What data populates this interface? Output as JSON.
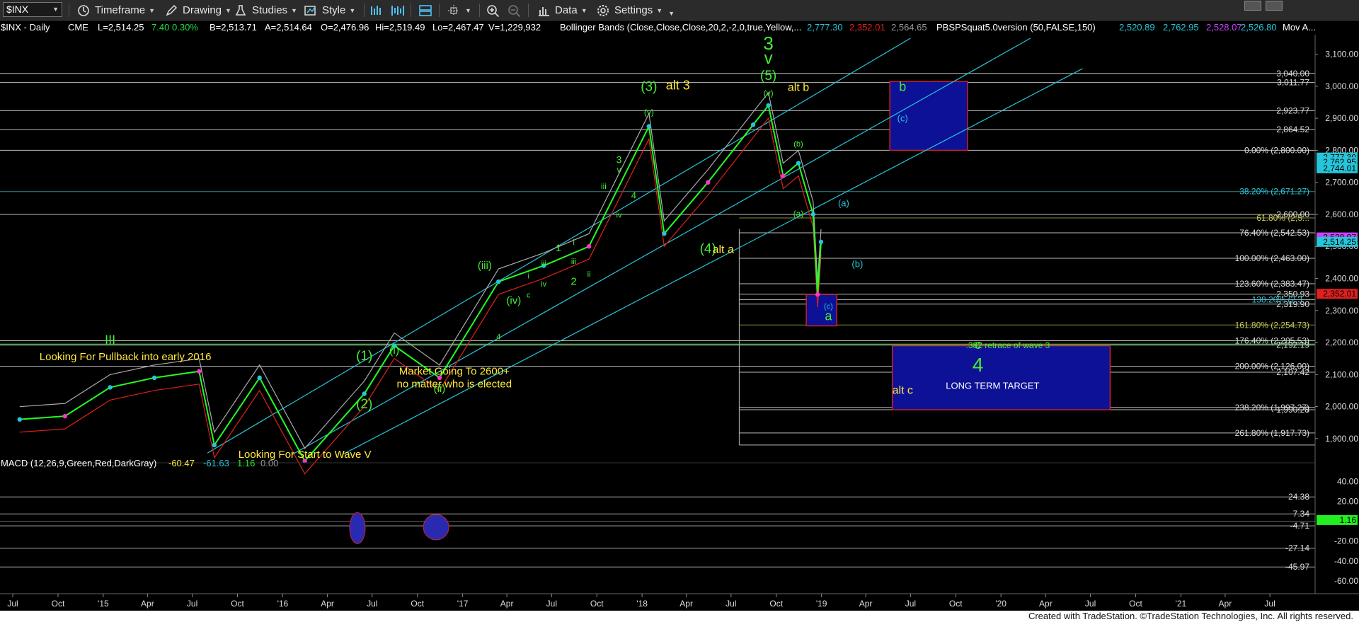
{
  "toolbar": {
    "symbol": "$INX",
    "timeframe": "Timeframe",
    "drawing": "Drawing",
    "studies": "Studies",
    "style": "Style",
    "data": "Data",
    "settings": "Settings"
  },
  "header": {
    "symbol_line": "$INX - Daily",
    "exchange": "CME",
    "last": "L=2,514.25",
    "change": "7.40",
    "pct": "0.30%",
    "bid": "B=2,513.71",
    "ask": "A=2,514.64",
    "open": "O=2,476.96",
    "high": "Hi=2,519.49",
    "low": "Lo=2,467.47",
    "volume": "V=1,229,932",
    "bb_label": "Bollinger Bands (Close,Close,Close,20,2,-2,0,true,Yellow,...",
    "bb_v1": "2,777.30",
    "bb_v2": "2,352.01",
    "bb_v3": "2,564.65",
    "pbs_label": "PBSPSquat5.0version (50,FALSE,150)",
    "pbs_v1": "2,520.89",
    "pbs_v2": "2,762.95",
    "pbs_v3": "2,528.07",
    "pbs_v4": "2,526.80",
    "mov": "Mov A..."
  },
  "macd_header": {
    "label": "MACD (12,26,9,Green,Red,DarkGray)",
    "v1": "-60.47",
    "v2": "-61.63",
    "v3": "1.16",
    "v4": "0.00"
  },
  "colors": {
    "price_up": "#22ff22",
    "price_down": "#ff2a2a",
    "bb_band": "#aaaaaa",
    "bb_red": "#e0201e",
    "cyan": "#26c6da",
    "yellow_text": "#ffea3b",
    "green_text": "#44ee33",
    "box_blue": "#0d1196",
    "box_border": "#cc2222",
    "macd_up": "#22ee22",
    "macd_down": "#ee2222"
  },
  "chart_data": [
    {
      "type": "line",
      "title": "$INX - Daily",
      "ylim": [
        1840,
        3150
      ],
      "y_ticks": [
        "3,100.00",
        "3,000.00",
        "2,900.00",
        "2,800.00",
        "2,700.00",
        "2,600.00",
        "2,500.00",
        "2,400.00",
        "2,300.00",
        "2,200.00",
        "2,100.00",
        "2,000.00",
        "1,900.00"
      ],
      "x_ticks": [
        "Jul",
        "Oct",
        "'15",
        "Apr",
        "Jul",
        "Oct",
        "'16",
        "Apr",
        "Jul",
        "Oct",
        "'17",
        "Apr",
        "Jul",
        "Oct",
        "'18",
        "Apr",
        "Jul",
        "Oct",
        "'19",
        "Apr",
        "Jul",
        "Oct",
        "'20",
        "Apr",
        "Jul",
        "Oct",
        "'21",
        "Apr",
        "Jul"
      ],
      "series": [
        {
          "x": [
            "2014-07",
            "2014-10",
            "2015-01",
            "2015-04",
            "2015-07",
            "2015-08",
            "2015-11",
            "2016-02",
            "2016-06",
            "2016-08",
            "2016-11",
            "2017-03",
            "2017-06",
            "2017-09",
            "2018-01",
            "2018-02",
            "2018-05",
            "2018-08",
            "2018-09",
            "2018-10",
            "2018-11",
            "2018-12",
            "2018-12-24",
            "2018-12-31"
          ],
          "values": [
            1960,
            1970,
            2060,
            2090,
            2110,
            1880,
            2090,
            1830,
            2040,
            2190,
            2090,
            2390,
            2440,
            2500,
            2875,
            2540,
            2700,
            2880,
            2940,
            2720,
            2760,
            2600,
            2350,
            2514
          ]
        }
      ],
      "price_levels": [
        {
          "label": "3,040.00",
          "value": 3040
        },
        {
          "label": "3,011.77",
          "value": 3011.77
        },
        {
          "label": "2,923.77",
          "value": 2923.77
        },
        {
          "label": "2,864.52",
          "value": 2864.52
        },
        {
          "label": "0.00% (2,800.00)",
          "value": 2800
        },
        {
          "label": "38.20% (2,671.27)",
          "value": 2671.27
        },
        {
          "label": "2,600.00",
          "value": 2600
        },
        {
          "label": "61.80% (2,5...",
          "value": 2589
        },
        {
          "label": "76.40% (2,542.53)",
          "value": 2542.53
        },
        {
          "label": "100.00% (2,463.00)",
          "value": 2463
        },
        {
          "label": "123.60% (2,383.47)",
          "value": 2383.47
        },
        {
          "label": "2,350.93",
          "value": 2350.93
        },
        {
          "label": "138.20% (2,3...",
          "value": 2334
        },
        {
          "label": "2,319.90",
          "value": 2319.9
        },
        {
          "label": "161.80% (2,254.73)",
          "value": 2254.73
        },
        {
          "label": "176.40% (2,205.53)",
          "value": 2205.53
        },
        {
          "label": "2,192.19",
          "value": 2192.19
        },
        {
          "label": "200.00% (2,126.00)",
          "value": 2126
        },
        {
          "label": "2,107.42",
          "value": 2107.42
        },
        {
          "label": "238.20% (1,997.27)",
          "value": 1997.27
        },
        {
          "label": "1,990.28",
          "value": 1990.28
        },
        {
          "label": "261.80% (1,917.73)",
          "value": 1917.73
        }
      ],
      "right_badges": [
        {
          "label": "2,777.30",
          "value": 2777.3,
          "color": "#26c6da"
        },
        {
          "label": "2,762.95",
          "value": 2762.95,
          "color": "#26c6da"
        },
        {
          "label": "2,744.01",
          "value": 2744,
          "color": "#26c6da"
        },
        {
          "label": "2,528.07",
          "value": 2528,
          "color": "#c844ff"
        },
        {
          "label": "2,514.25",
          "value": 2514.25,
          "color": "#26c6da"
        },
        {
          "label": "2,352.01",
          "value": 2352,
          "color": "#e0201e"
        }
      ],
      "annotations": [
        {
          "text": "3",
          "date": "2018-09",
          "value": 3115,
          "color": "#44ee33",
          "size": 26
        },
        {
          "text": "v",
          "date": "2018-09",
          "value": 3070,
          "color": "#44ee33",
          "size": 24
        },
        {
          "text": "(5)",
          "date": "2018-09",
          "value": 3020,
          "color": "#44ee33",
          "size": 19
        },
        {
          "text": "(v)",
          "date": "2018-09",
          "value": 2970,
          "color": "#44ee33",
          "size": 12
        },
        {
          "text": "alt b",
          "date": "2018-11",
          "value": 2985,
          "color": "#ffea3b",
          "size": 16
        },
        {
          "text": "(3)",
          "date": "2018-01",
          "value": 2985,
          "color": "#44ee33",
          "size": 19
        },
        {
          "text": "alt 3",
          "date": "2018-03",
          "value": 2990,
          "color": "#ffea3b",
          "size": 18
        },
        {
          "text": "(v)",
          "date": "2018-01",
          "value": 2910,
          "color": "#44ee33",
          "size": 12
        },
        {
          "text": "3",
          "date": "2017-11",
          "value": 2760,
          "color": "#44ee33",
          "size": 14
        },
        {
          "text": "v",
          "date": "2017-11",
          "value": 2730,
          "color": "#44ee33",
          "size": 12
        },
        {
          "text": "iii",
          "date": "2017-10",
          "value": 2680,
          "color": "#44ee33",
          "size": 12
        },
        {
          "text": "4",
          "date": "2017-12",
          "value": 2650,
          "color": "#44ee33",
          "size": 13
        },
        {
          "text": "iv",
          "date": "2017-11",
          "value": 2590,
          "color": "#44ee33",
          "size": 11
        },
        {
          "text": "(4)",
          "date": "2018-05",
          "value": 2480,
          "color": "#44ee33",
          "size": 19
        },
        {
          "text": "alt a",
          "date": "2018-06",
          "value": 2480,
          "color": "#ffea3b",
          "size": 16
        },
        {
          "text": "(b)",
          "date": "2018-11",
          "value": 2812,
          "color": "#44ee33",
          "size": 11
        },
        {
          "text": "(a)",
          "date": "2018-11",
          "value": 2593,
          "color": "#44ee33",
          "size": 12
        },
        {
          "text": "(c)",
          "date": "2019-01",
          "value": 2305,
          "color": "#26c6da",
          "size": 11
        },
        {
          "text": "a",
          "date": "2019-01",
          "value": 2270,
          "color": "#44ee33",
          "size": 18
        },
        {
          "text": "(a)",
          "date": "2019-02",
          "value": 2625,
          "color": "#26c6da",
          "size": 13
        },
        {
          "text": "(b)",
          "date": "2019-03",
          "value": 2435,
          "color": "#26c6da",
          "size": 13
        },
        {
          "text": "(iii)",
          "date": "2017-02",
          "value": 2430,
          "color": "#44ee33",
          "size": 15
        },
        {
          "text": "i",
          "date": "2017-05",
          "value": 2400,
          "color": "#44ee33",
          "size": 11
        },
        {
          "text": "iii",
          "date": "2017-06",
          "value": 2440,
          "color": "#44ee33",
          "size": 11
        },
        {
          "text": "iv",
          "date": "2017-06",
          "value": 2375,
          "color": "#44ee33",
          "size": 11
        },
        {
          "text": "(iv)",
          "date": "2017-04",
          "value": 2320,
          "color": "#44ee33",
          "size": 15
        },
        {
          "text": "c",
          "date": "2017-05",
          "value": 2340,
          "color": "#44ee33",
          "size": 11
        },
        {
          "text": "1",
          "date": "2017-07",
          "value": 2485,
          "color": "#44ee33",
          "size": 14
        },
        {
          "text": "i",
          "date": "2017-08",
          "value": 2505,
          "color": "#44ee33",
          "size": 11
        },
        {
          "text": "iii",
          "date": "2017-08",
          "value": 2445,
          "color": "#44ee33",
          "size": 11
        },
        {
          "text": "ii",
          "date": "2017-09",
          "value": 2405,
          "color": "#44ee33",
          "size": 11
        },
        {
          "text": "2",
          "date": "2017-08",
          "value": 2380,
          "color": "#44ee33",
          "size": 15
        },
        {
          "text": "III",
          "date": "2015-01",
          "value": 2195,
          "color": "#44ee33",
          "size": 18
        },
        {
          "text": "Looking For Pullback into early 2016",
          "date": "2015-02",
          "value": 2145,
          "color": "#ffea3b",
          "size": 15
        },
        {
          "text": "(1)",
          "date": "2016-06",
          "value": 2145,
          "color": "#44ee33",
          "size": 19
        },
        {
          "text": "(i)",
          "date": "2016-08",
          "value": 2165,
          "color": "#44ee33",
          "size": 16
        },
        {
          "text": "(2)",
          "date": "2016-06",
          "value": 1995,
          "color": "#44ee33",
          "size": 19
        },
        {
          "text": "(ii)",
          "date": "2016-11",
          "value": 2045,
          "color": "#44ee33",
          "size": 15
        },
        {
          "text": "Market Going To 2600+",
          "date": "2016-12",
          "value": 2100,
          "color": "#ffea3b",
          "size": 15
        },
        {
          "text": "no matter who is elected",
          "date": "2016-12",
          "value": 2060,
          "color": "#ffea3b",
          "size": 15
        },
        {
          "text": "Looking For Start to Wave V",
          "date": "2016-02",
          "value": 1840,
          "color": "#ffea3b",
          "size": 15
        },
        {
          "text": "4",
          "date": "2017-03",
          "value": 2210,
          "color": "#44ee33",
          "size": 11
        },
        {
          "text": "b",
          "date": "2019-06",
          "value": 2985,
          "color": "#44ee33",
          "size": 18
        },
        {
          "text": "(c)",
          "date": "2019-06",
          "value": 2890,
          "color": "#26c6da",
          "size": 13
        },
        {
          "text": "c",
          "date": "2019-11",
          "value": 2180,
          "color": "#44ee33",
          "size": 18
        },
        {
          "text": ".382 retrace of wave 3",
          "date": "2020-01",
          "value": 2182,
          "color": "#44ee33",
          "size": 12
        },
        {
          "text": "4",
          "date": "2019-11",
          "value": 2110,
          "color": "#44ee33",
          "size": 28
        },
        {
          "text": "LONG TERM TARGET",
          "date": "2019-12",
          "value": 2055,
          "color": "#ffffff",
          "size": 13
        },
        {
          "text": "alt c",
          "date": "2019-06",
          "value": 2040,
          "color": "#ffea3b",
          "size": 16
        }
      ]
    },
    {
      "type": "bar",
      "title": "MACD (12,26,9,Green,Red,DarkGray)",
      "ylim": [
        -70,
        48
      ],
      "y_ticks": [
        "40.00",
        "20.00",
        "-20.00",
        "-40.00",
        "-60.00"
      ],
      "level_labels": [
        "24.38",
        "7.34",
        "-4.71",
        "-27.14",
        "-45.97"
      ],
      "levels": [
        24.38,
        7.34,
        -4.71,
        -27.14,
        -45.97
      ],
      "histogram_last": 1.16
    }
  ]
}
